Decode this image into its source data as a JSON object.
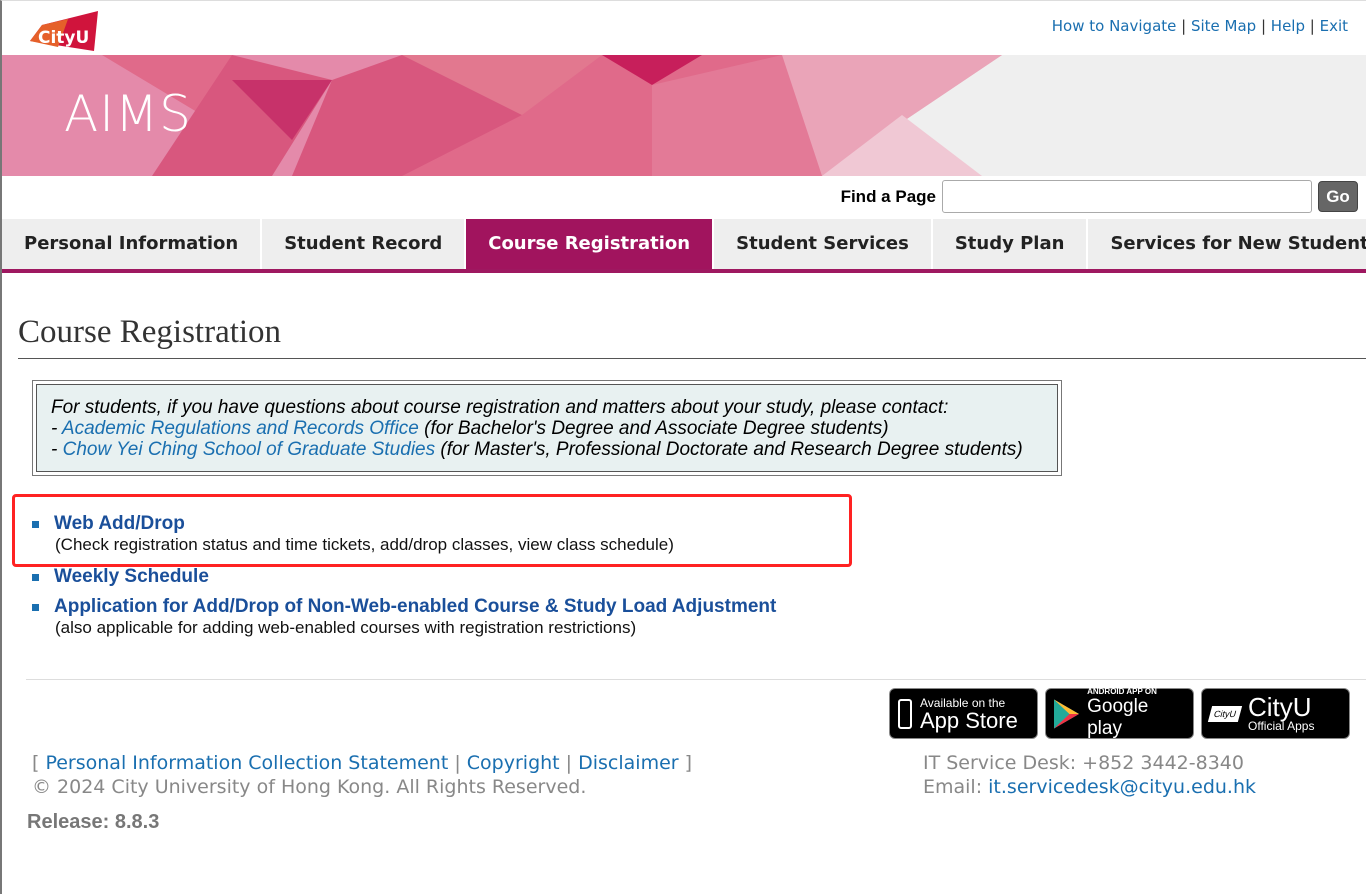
{
  "header": {
    "logo_text": "CityU",
    "top_links": [
      "How to Navigate",
      "Site Map",
      "Help",
      "Exit"
    ],
    "banner_title": "AIMS"
  },
  "search": {
    "label": "Find a Page",
    "value": "",
    "button": "Go"
  },
  "nav": [
    {
      "label": "Personal Information"
    },
    {
      "label": "Student Record"
    },
    {
      "label": "Course Registration",
      "active": true
    },
    {
      "label": "Student Services"
    },
    {
      "label": "Study Plan"
    },
    {
      "label": "Services for New Student"
    }
  ],
  "page_title": "Course Registration",
  "info": {
    "intro": "For students, if you have questions about course registration and matters about your study, please contact:",
    "line1_link": "Academic Regulations and Records Office",
    "line1_note": " (for Bachelor's Degree and Associate Degree students)",
    "line2_link": "Chow Yei Ching School of Graduate Studies",
    "line2_note": " (for Master's, Professional Doctorate and Research Degree students)"
  },
  "links": [
    {
      "title": "Web Add/Drop",
      "desc": "(Check registration status and time tickets, add/drop classes, view class schedule)"
    },
    {
      "title": "Weekly Schedule",
      "desc": ""
    },
    {
      "title": "Application for Add/Drop of Non-Web-enabled Course & Study Load Adjustment",
      "desc": "(also applicable for adding web-enabled courses with registration restrictions)"
    }
  ],
  "apps": [
    {
      "small": "Available on the",
      "big": "App Store",
      "icon": "apple-phone-icon"
    },
    {
      "small": "ANDROID APP ON",
      "big": "Google play",
      "icon": "google-play-icon"
    },
    {
      "small": "Official Apps",
      "big": "CityU",
      "icon": "cityu-logo-icon"
    }
  ],
  "footer": {
    "links": [
      "Personal Information Collection Statement",
      "Copyright",
      "Disclaimer"
    ],
    "copyright": "© 2024 City University of Hong Kong. All Rights Reserved.",
    "service_desk": "IT Service Desk: +852 3442-8340",
    "email_label": "Email: ",
    "email": "it.servicedesk@cityu.edu.hk",
    "release": "Release: 8.8.3"
  },
  "colors": {
    "accent": "#a1145e",
    "link": "#1a6fb0",
    "highlight": "#ff2222"
  }
}
